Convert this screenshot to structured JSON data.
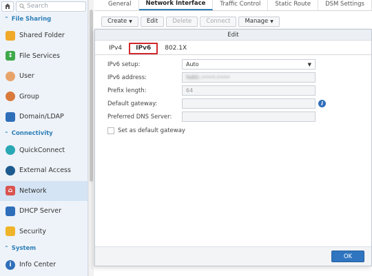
{
  "sidebar": {
    "search_placeholder": "Search",
    "sections": {
      "file_sharing": "File Sharing",
      "connectivity": "Connectivity",
      "system": "System"
    },
    "items": [
      {
        "label": "Shared Folder",
        "icon": "folder-icon"
      },
      {
        "label": "File Services",
        "icon": "file-services-icon"
      },
      {
        "label": "User",
        "icon": "user-icon"
      },
      {
        "label": "Group",
        "icon": "group-icon"
      },
      {
        "label": "Domain/LDAP",
        "icon": "domain-icon"
      },
      {
        "label": "QuickConnect",
        "icon": "quickconnect-icon"
      },
      {
        "label": "External Access",
        "icon": "globe-icon"
      },
      {
        "label": "Network",
        "icon": "network-icon",
        "active": true
      },
      {
        "label": "DHCP Server",
        "icon": "dhcp-icon"
      },
      {
        "label": "Security",
        "icon": "shield-icon"
      },
      {
        "label": "Info Center",
        "icon": "info-icon"
      }
    ]
  },
  "tabs": [
    "General",
    "Network Interface",
    "Traffic Control",
    "Static Route",
    "DSM Settings"
  ],
  "toolbar": {
    "create": "Create",
    "edit": "Edit",
    "delete": "Delete",
    "connect": "Connect",
    "manage": "Manage"
  },
  "modal": {
    "title": "Edit",
    "tabs": [
      "IPv4",
      "IPv6",
      "802.1X"
    ],
    "active_tab": "IPv6",
    "fields": {
      "ipv6_setup_label": "IPv6 setup:",
      "ipv6_setup_value": "Auto",
      "ipv6_address_label": "IPv6 address:",
      "ipv6_address_value": "fe80::••••:••••",
      "prefix_length_label": "Prefix length:",
      "prefix_length_value": "64",
      "default_gateway_label": "Default gateway:",
      "preferred_dns_label": "Preferred DNS Server:",
      "set_default_gateway_label": "Set as default gateway"
    },
    "ok_label": "OK"
  },
  "colors": {
    "accent": "#2d7fb8",
    "highlight_border": "#d0262a",
    "ok_button": "#2f75c0"
  }
}
